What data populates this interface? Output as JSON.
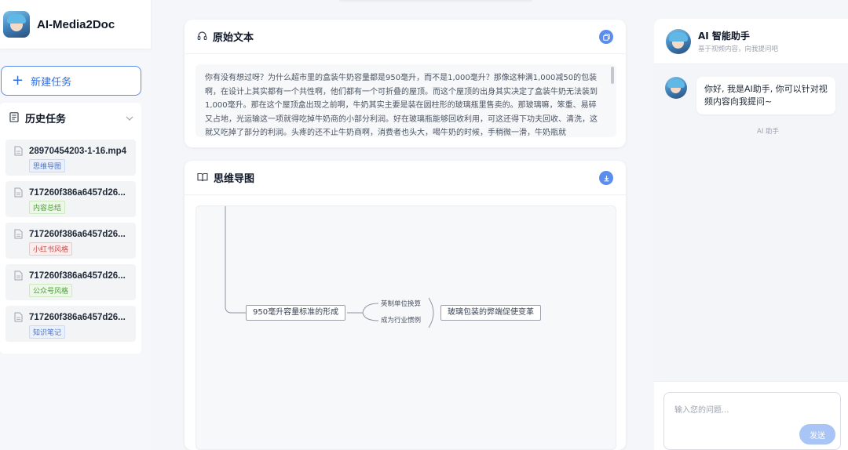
{
  "brand": {
    "name": "AI-Media2Doc"
  },
  "sidebar": {
    "new_task_label": "新建任务",
    "history_title": "历史任务",
    "items": [
      {
        "name": "28970454203-1-16.mp4",
        "tag": "思维导图",
        "tag_color": "#4a72c9"
      },
      {
        "name": "717260f386a6457d26...",
        "tag": "内容总结",
        "tag_color": "#4f9a3e"
      },
      {
        "name": "717260f386a6457d26...",
        "tag": "小红书风格",
        "tag_color": "#c94b4b"
      },
      {
        "name": "717260f386a6457d26...",
        "tag": "公众号风格",
        "tag_color": "#4f9a3e"
      },
      {
        "name": "717260f386a6457d26...",
        "tag": "知识笔记",
        "tag_color": "#4a72c9"
      }
    ]
  },
  "original": {
    "title": "原始文本",
    "text": "你有没有想过呀？为什么超市里的盒装牛奶容量都是950毫升，而不是1,000毫升？那像这种满1,000减50的包装啊，在设计上其实都有一个共性啊，他们都有一个可折叠的屋顶。而这个屋顶的出身其实决定了盒装牛奶无法装到1,000毫升。那在这个屋顶盒出现之前啊，牛奶其实主要是装在圆柱形的玻璃瓶里售卖的。那玻璃嘛，笨重、易碎又占地，光运输这一项就得吃掉牛奶商的小部分利润。好在玻璃瓶能够回收利用，可这还得下功夫回收、清洗，这就又吃掉了部分的利润。头疼的还不止牛奶商啊，消费者也头大，喝牛奶的时候，手稍微一滑，牛奶瓶就"
  },
  "mindmap": {
    "title": "思维导图",
    "main_node": "950毫升容量标准的形成",
    "branches": [
      "英制单位换算",
      "成为行业惯例"
    ],
    "result_node": "玻璃包装的弊端促使变革"
  },
  "chat": {
    "title": "AI 智能助手",
    "subtitle": "基于视频内容，向我提问吧",
    "message": "你好, 我是AI助手, 你可以针对视频内容向我提问~",
    "sender": "AI 助手",
    "placeholder": "输入您的问题...",
    "send_label": "发送"
  },
  "colors": {
    "accent": "#5b8def",
    "send_disabled": "#a9c5f5"
  }
}
